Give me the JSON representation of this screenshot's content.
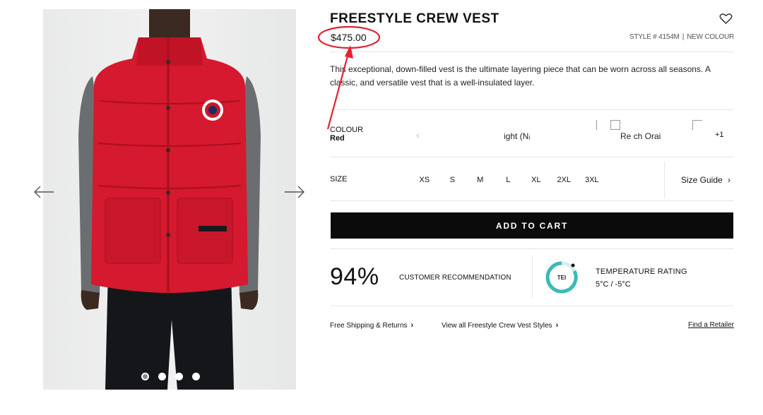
{
  "gallery": {
    "image_alt": "Model wearing red Freestyle Crew Vest over grey long-sleeve top",
    "dots": 4,
    "active_dot": 0
  },
  "product": {
    "title": "FREESTYLE CREW VEST",
    "price": "$475.00",
    "style_number": "STYLE # 4154M",
    "tag": "NEW COLOUR",
    "description": "This exceptional, down-filled vest is the ultimate layering piece that can be worn across all seasons. A classic, and versatile vest that is a well-insulated layer."
  },
  "colour": {
    "label": "COLOUR",
    "selected": "Red",
    "swatch_1": "ight (Nᵢ",
    "swatch_2": "Re ch Orai",
    "more": "+1"
  },
  "size": {
    "label": "SIZE",
    "options": [
      "XS",
      "S",
      "M",
      "L",
      "XL",
      "2XL",
      "3XL"
    ],
    "guide": "Size Guide"
  },
  "cart": {
    "add_label": "ADD TO CART"
  },
  "stats": {
    "recommendation_pct": "94%",
    "recommendation_label": "CUSTOMER RECOMMENDATION",
    "temp_badge": "TEI",
    "temp_title": "TEMPERATURE RATING",
    "temp_range": "5°C / -5°C"
  },
  "links": {
    "shipping": "Free Shipping & Returns",
    "view_all": "View all Freestyle Crew Vest Styles",
    "retailer": "Find a Retailer"
  },
  "icons": {
    "heart": "heart-icon",
    "arrow_left": "arrow-left-icon",
    "arrow_right": "arrow-right-icon",
    "chevron": "chevron-right-icon"
  },
  "colors": {
    "vest_red": "#d5192e",
    "button": "#0b0b0b",
    "annotation": "#e3202d",
    "temp_teal": "#3bb9b5"
  }
}
